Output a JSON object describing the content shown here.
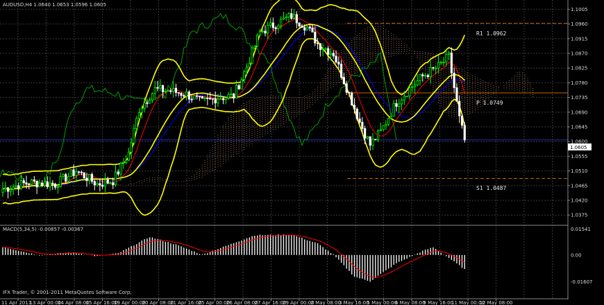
{
  "header": {
    "symbol_line": "AUDUSD,H4  1.0640 1.0653 1.0596 1.0605",
    "macd_line": "MACD(5,34,5) -0.00857 -0.00367",
    "copyright": "IFX Trader, © 2001-2011 MetaQuotes Software Corp."
  },
  "levels": {
    "r1": "R1 1.0962",
    "p": "P 1.0749",
    "s1": "S1 1.0487"
  },
  "price_axis": {
    "ticks": [
      "1.1005",
      "1.0960",
      "1.0915",
      "1.0870",
      "1.0825",
      "1.0780",
      "1.0735",
      "1.0690",
      "1.0645",
      "1.0600",
      "1.0555",
      "1.0510",
      "1.0465",
      "1.0420",
      "1.0375"
    ],
    "current_price": "1.0605"
  },
  "macd_axis": {
    "ticks": [
      "0.01541",
      "0.00",
      "-0.01607"
    ]
  },
  "time_axis": {
    "labels": [
      "11 Apr 2011",
      "13 Apr 00:00",
      "14 Apr 08:00",
      "15 Apr 16:00",
      "19 Apr 00:00",
      "20 Apr 08:00",
      "21 Apr 16:00",
      "25 Apr 00:00",
      "26 Apr 08:00",
      "27 Apr 16:00",
      "29 Apr 00:00",
      "2 May 08:00",
      "3 May 16:00",
      "5 May 00:00",
      "6 May 08:00",
      "9 May 16:00",
      "11 May 00:00",
      "12 May 08:00"
    ]
  },
  "colors": {
    "background": "#000000",
    "grid": "#3a3a3a",
    "bull_candle": "#00ff00",
    "bear_candle": "#ffffff",
    "bollinger": "#ffff00",
    "tenkan": "#ff0000",
    "kijun": "#0000ff",
    "chikou": "#00a000",
    "cloud": "#c89070",
    "pivot": "#c86400",
    "macd_hist": "#ffffff",
    "macd_signal": "#ff0000"
  },
  "chart_data": {
    "type": "candlestick",
    "symbol": "AUDUSD",
    "timeframe": "H4",
    "ylim": [
      1.035,
      1.1025
    ],
    "pivots": {
      "R1": 1.0962,
      "P": 1.0749,
      "S1": 1.0487
    },
    "current_price": 1.0605,
    "close_anchors": [
      [
        0,
        1.0455
      ],
      [
        10,
        1.0475
      ],
      [
        20,
        1.047
      ],
      [
        28,
        1.051
      ],
      [
        36,
        1.047
      ],
      [
        42,
        1.048
      ],
      [
        48,
        1.0565
      ],
      [
        52,
        1.07
      ],
      [
        58,
        1.076
      ],
      [
        64,
        1.0755
      ],
      [
        70,
        1.0745
      ],
      [
        76,
        1.072
      ],
      [
        82,
        1.0735
      ],
      [
        88,
        1.074
      ],
      [
        93,
        1.083
      ],
      [
        98,
        1.0935
      ],
      [
        104,
        1.096
      ],
      [
        110,
        1.0985
      ],
      [
        116,
        1.095
      ],
      [
        120,
        1.09
      ],
      [
        126,
        1.087
      ],
      [
        132,
        1.0745
      ],
      [
        136,
        1.066
      ],
      [
        140,
        1.059
      ],
      [
        144,
        1.063
      ],
      [
        150,
        1.072
      ],
      [
        156,
        1.077
      ],
      [
        160,
        1.08
      ],
      [
        166,
        1.083
      ],
      [
        170,
        1.086
      ],
      [
        172,
        1.0765
      ],
      [
        174,
        1.067
      ],
      [
        176,
        1.0605
      ]
    ],
    "macd_anchors": [
      [
        0,
        0.0048
      ],
      [
        14,
        -0.0002
      ],
      [
        26,
        0.0016
      ],
      [
        36,
        -0.0008
      ],
      [
        44,
        0.001
      ],
      [
        56,
        0.0108
      ],
      [
        66,
        0.0062
      ],
      [
        76,
        0.0002
      ],
      [
        82,
        0.0036
      ],
      [
        96,
        0.0118
      ],
      [
        110,
        0.0122
      ],
      [
        120,
        0.0068
      ],
      [
        126,
        0.0002
      ],
      [
        134,
        -0.013
      ],
      [
        140,
        -0.0158
      ],
      [
        150,
        -0.005
      ],
      [
        160,
        0.0024
      ],
      [
        164,
        0.0046
      ],
      [
        170,
        -0.0018
      ],
      [
        176,
        -0.0086
      ]
    ],
    "macd_ylim": [
      -0.0175,
      0.0165
    ]
  }
}
